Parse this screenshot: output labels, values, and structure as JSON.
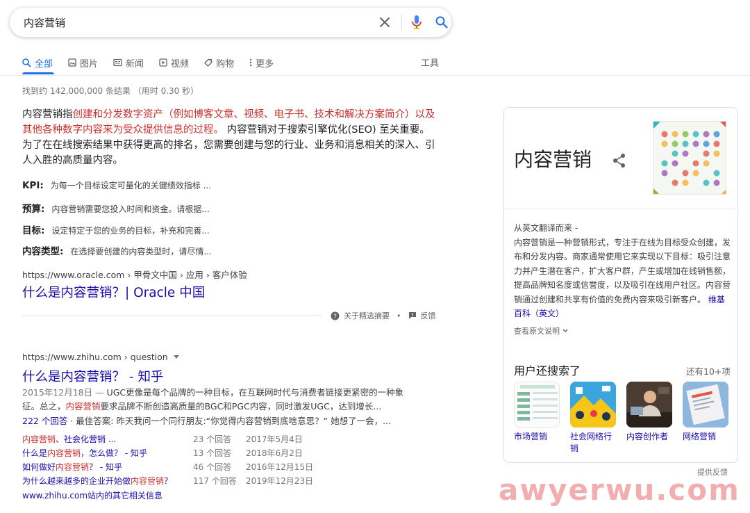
{
  "search": {
    "query": "内容营销"
  },
  "tabs": [
    {
      "label": "全部",
      "icon": "search-icon"
    },
    {
      "label": "图片",
      "icon": "image-icon"
    },
    {
      "label": "新闻",
      "icon": "news-icon"
    },
    {
      "label": "视频",
      "icon": "video-icon"
    },
    {
      "label": "购物",
      "icon": "tag-icon"
    },
    {
      "label": "更多",
      "icon": "more-vert-icon"
    }
  ],
  "tools_label": "工具",
  "stats": "找到约 142,000,000 条结果 （用时 0.30 秒）",
  "featured": {
    "lead": "内容营销指",
    "highlight": "创建和分发数字资产（例如博客文章、视频、电子书、技术和解决方案简介）以及其他各种数字内容来为受众提供信息的过程。",
    "rest": " 内容营销对于搜索引擎优化(SEO) 至关重要。 为了在在线搜索结果中获得更高的排名，您需要创建与您的行业、业务和消息相关的深入、引人入胜的高质量内容。",
    "facts": [
      {
        "key": "KPI:",
        "value": "为每一个目标设定可量化的关键绩效指标 ..."
      },
      {
        "key": "预算:",
        "value": "内容营销需要您投入时间和资金。请根据..."
      },
      {
        "key": "目标:",
        "value": "设定特定于您的业务的目标，补充和完善..."
      },
      {
        "key": "内容类型:",
        "value": "在选择要创建的内容类型时，请尽情..."
      }
    ],
    "cite": "https://www.oracle.com › 甲骨文中国 › 应用 › 客户体验",
    "title": "什么是内容营销？| Oracle 中国",
    "about": "关于精选摘要",
    "dot": "•",
    "feedback": "反馈"
  },
  "result2": {
    "cite": "https://www.zhihu.com › question",
    "title": "什么是内容营销？ - 知乎",
    "desc_date": "2015年12月18日 — ",
    "desc_a": "UGC更像是每个品牌的一种目标，在互联网时代与消费者链接更紧密的一种象征。总之，",
    "desc_hl": "内容营销",
    "desc_b": "要求品牌不断创造高质量的BGC和PGC内容，同时激发UGC，达到增长...",
    "answers_a": "222 个回答",
    "answers_b": " · 最佳答案: 昨天我问一个同行朋友:“你觉得内容营销到底啥意思？” 她想了一会，...",
    "subs": [
      {
        "pre": "",
        "hl": "内容营销",
        "post": "、社会化营销 ...",
        "count": "23 个回答",
        "date": "2017年5月4日"
      },
      {
        "pre": "什么是",
        "hl": "内容营销",
        "post": "，怎么做？ - 知乎",
        "count": "13 个回答",
        "date": "2018年6月2日"
      },
      {
        "pre": "如何做好",
        "hl": "内容营销",
        "post": "？ - 知乎",
        "count": "46 个回答",
        "date": "2016年12月15日"
      },
      {
        "pre": "为什么越来越多的企业开始做",
        "hl": "内容营销",
        "post": "？",
        "count": "117 个回答",
        "date": "2019年12月23日"
      }
    ],
    "more": "www.zhihu.com站内的其它相关信息"
  },
  "knowledge": {
    "title": "内容营销",
    "translated": "从英文翻译而来 -",
    "body": "内容营销是一种营销形式，专注于在线为目标受众创建，发布和分发内容。商家通常使用它来实现以下目标：吸引注意力并产生潜在客户，扩大客户群，产生或增加在线销售额，提高品牌知名度或信誉度，以及吸引在线用户社区。内容营销通过创建和共享有价值的免费内容来吸引新客户。",
    "wiki": "维基百科（英文）",
    "view_original": "查看原文说明",
    "also_title": "用户还搜索了",
    "also_more": "还有10+项",
    "also": [
      {
        "label": "市场营销"
      },
      {
        "label": "社会网络行销"
      },
      {
        "label": "内容创作者"
      },
      {
        "label": "网络营销"
      }
    ],
    "feedback": "提供反馈"
  },
  "watermark": "awyerwu.com",
  "colors": {
    "accent": "#1a73e8",
    "link": "#1a0dab",
    "highlight": "#c9302c",
    "mic_blue": "#4285f4",
    "mic_red": "#ea4335"
  }
}
